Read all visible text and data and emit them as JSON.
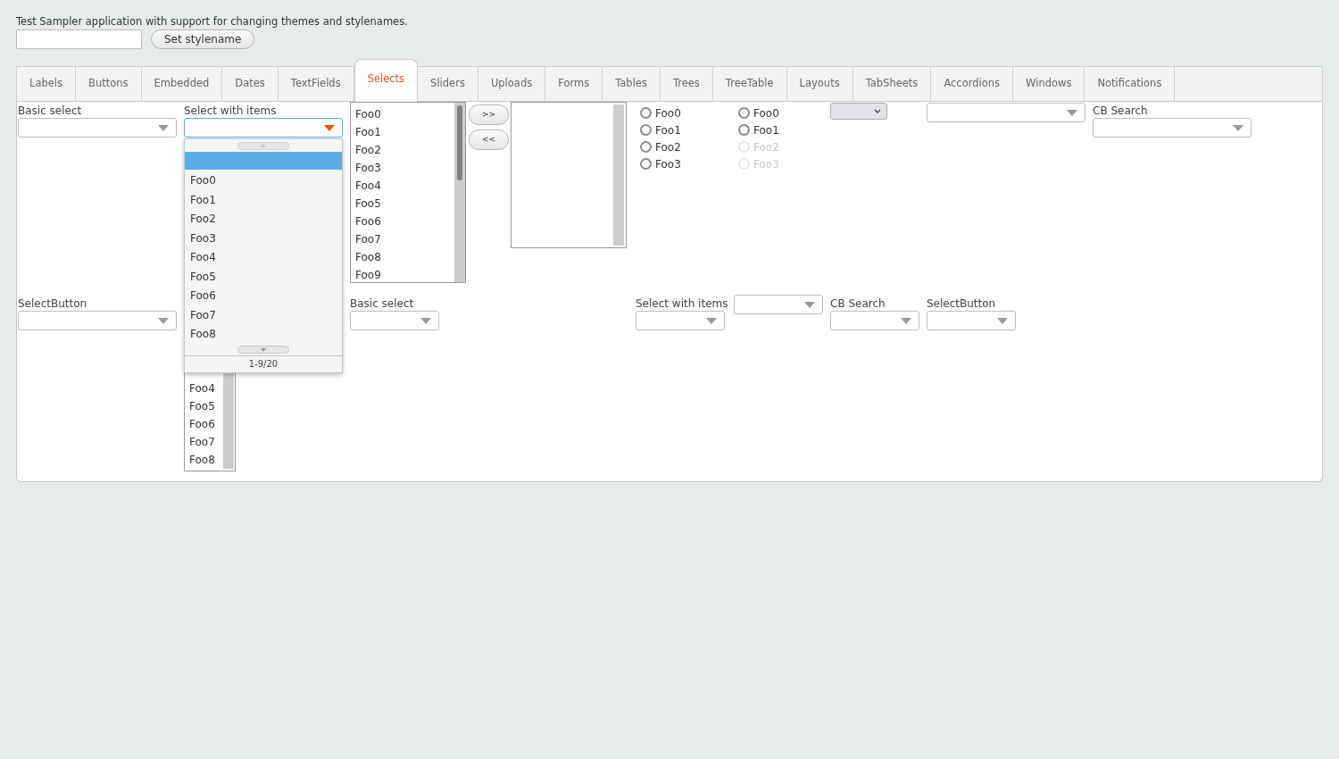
{
  "description": "Test Sampler application with support for changing themes and stylenames.",
  "set_button": "Set stylename",
  "tabs": [
    {
      "label": "Labels",
      "selected": false
    },
    {
      "label": "Buttons",
      "selected": false
    },
    {
      "label": "Embedded",
      "selected": false
    },
    {
      "label": "Dates",
      "selected": false
    },
    {
      "label": "TextFields",
      "selected": false
    },
    {
      "label": "Selects",
      "selected": true
    },
    {
      "label": "Sliders",
      "selected": false
    },
    {
      "label": "Uploads",
      "selected": false
    },
    {
      "label": "Forms",
      "selected": false
    },
    {
      "label": "Tables",
      "selected": false
    },
    {
      "label": "Trees",
      "selected": false
    },
    {
      "label": "TreeTable",
      "selected": false
    },
    {
      "label": "Layouts",
      "selected": false
    },
    {
      "label": "TabSheets",
      "selected": false
    },
    {
      "label": "Accordions",
      "selected": false
    },
    {
      "label": "Windows",
      "selected": false
    },
    {
      "label": "Notifications",
      "selected": false
    }
  ],
  "basic_select": {
    "label": "Basic select"
  },
  "select_with_items": {
    "label": "Select with items",
    "focused": true,
    "popup": {
      "null_item": {
        "selected": true
      },
      "items": [
        {
          "label": "Foo0",
          "selected": false
        },
        {
          "label": "Foo1",
          "selected": false
        },
        {
          "label": "Foo2",
          "selected": false
        },
        {
          "label": "Foo3",
          "selected": false
        },
        {
          "label": "Foo4",
          "selected": false
        },
        {
          "label": "Foo5",
          "selected": false
        },
        {
          "label": "Foo6",
          "selected": false
        },
        {
          "label": "Foo7",
          "selected": false
        },
        {
          "label": "Foo8",
          "selected": false
        }
      ],
      "page": "1-9/20"
    }
  },
  "list_select": {
    "items": [
      "Foo0",
      "Foo1",
      "Foo2",
      "Foo3",
      "Foo4",
      "Foo5",
      "Foo6",
      "Foo7",
      "Foo8",
      "Foo9"
    ]
  },
  "twin_buttons": [
    ">>",
    "<<"
  ],
  "radio_groups": [
    {
      "items": [
        {
          "label": "Foo0",
          "selected": false,
          "disabled": false
        },
        {
          "label": "Foo1",
          "selected": false,
          "disabled": false
        },
        {
          "label": "Foo2",
          "selected": false,
          "disabled": false
        },
        {
          "label": "Foo3",
          "selected": false,
          "disabled": false
        }
      ]
    },
    {
      "items": [
        {
          "label": "Foo0",
          "selected": false,
          "disabled": false
        },
        {
          "label": "Foo1",
          "selected": false,
          "disabled": false
        },
        {
          "label": "Foo2",
          "selected": false,
          "disabled": true
        },
        {
          "label": "Foo3",
          "selected": false,
          "disabled": true
        }
      ]
    }
  ],
  "cb_search": {
    "label": "CB Search"
  },
  "select_button": {
    "label": "SelectButton"
  },
  "list_select_lower": {
    "items": [
      "Foo4",
      "Foo5",
      "Foo6",
      "Foo7",
      "Foo8"
    ]
  },
  "basic_select_lower": {
    "label": "Basic select"
  },
  "select_with_items_lower": {
    "label": "Select with items"
  },
  "cb_search_lower": {
    "label": "CB Search"
  },
  "select_button_lower": {
    "label": "SelectButton"
  }
}
